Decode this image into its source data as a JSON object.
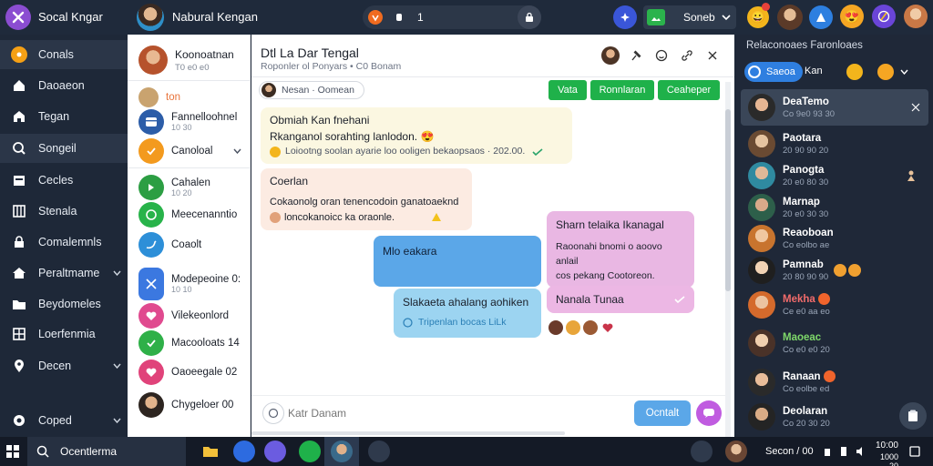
{
  "topbar": {
    "app_title": "Socal Kngar",
    "profile_name": "Nabural Kengan",
    "search_count": "1",
    "green_button": "Soneb"
  },
  "sidebar": {
    "items": [
      {
        "label": "Conals",
        "icon": "orange-circle-icon"
      },
      {
        "label": "Daoaeon",
        "icon": "home-icon"
      },
      {
        "label": "Tegan",
        "icon": "home-icon"
      },
      {
        "label": "Songeil",
        "icon": "chat-icon"
      },
      {
        "label": "Cecles",
        "icon": "calendar-icon"
      },
      {
        "label": "Stenala",
        "icon": "grid-icon"
      },
      {
        "label": "Comalemnls",
        "icon": "lock-icon"
      },
      {
        "label": "Peraltmame",
        "icon": "home-icon"
      },
      {
        "label": "Beydomeles",
        "icon": "folder-icon"
      },
      {
        "label": "Loerfenmia",
        "icon": "grid-icon"
      },
      {
        "label": "Decen",
        "icon": "location-icon"
      },
      {
        "label": "Coped",
        "icon": "settings-icon"
      }
    ]
  },
  "contacts": {
    "header_name": "Koonoatnan",
    "header_sub": "T0 e0 e0",
    "items": [
      {
        "label": "ton",
        "sub": "",
        "color": "#c9a36f"
      },
      {
        "label": "Fannelloohnel",
        "sub": "10 30",
        "color": "#2c5da8"
      },
      {
        "label": "Canoloal",
        "sub": "",
        "color": "#f39a1e"
      },
      {
        "label": "Cahalen",
        "sub": "10 20",
        "color": "#2c9e43"
      },
      {
        "label": "Meecenanntio",
        "sub": "",
        "color": "#28b34a"
      },
      {
        "label": "Coaolt",
        "sub": "",
        "color": "#2d8fd8"
      },
      {
        "label": "Modepeoine 0:",
        "sub": "10 10",
        "color": "#3b78e0"
      },
      {
        "label": "Vilekeonlord",
        "sub": "",
        "color": "#e04a8f"
      },
      {
        "label": "Macooloats 14",
        "sub": "",
        "color": "#2fb048"
      },
      {
        "label": "Oaoeegale 02",
        "sub": "",
        "color": "#e0437a"
      },
      {
        "label": "Chygeloer 00",
        "sub": "",
        "color": "#8a5a3a"
      }
    ]
  },
  "chat": {
    "title": "Dtl La Dar Tengal",
    "subtitle": "Roponler ol Ponyars • C0 Bonam",
    "search_placeholder": "Nesan · Oomean",
    "buttons": [
      "Vata",
      "Ronnlaran",
      "Ceaheper"
    ],
    "messages": [
      {
        "text1": "Obmiah Kan fnehani",
        "text2": "Rkanganol sorahting lanlodon. 😍",
        "text3": "Loiootng soolan ayarie loo ooligen bekaopsaos · 202.00."
      },
      {
        "title": "Coerlan",
        "text1": "Cokaonolg oran tenencodoin ganatoaeknd",
        "text2": "loncokanoicc ka oraonle."
      },
      {
        "title": "Sharn telaika Ikanagal",
        "text1": "Raoonahi bnomi o aoovo anlail",
        "text2": "cos pekang Cootoreon."
      },
      {
        "text1": "Mlo eakara"
      },
      {
        "title": "Slakaeta ahalang aohiken",
        "text1": "Tripenlan bocas LiLk"
      },
      {
        "text1": "Nanala Tunaa"
      }
    ],
    "input_placeholder": "Katr Danam",
    "send_button": "Ocntalt"
  },
  "right": {
    "header": "Relaconoaes Faronloaes",
    "filter": "Saeoa",
    "filter2": "Kan",
    "contacts": [
      {
        "name": "DeaTemo",
        "sub": "Co 9e0 93 30"
      },
      {
        "name": "Paotara",
        "sub": "20 90 90 20"
      },
      {
        "name": "Panogta",
        "sub": "20 e0 80 30"
      },
      {
        "name": "Marnap",
        "sub": "20 e0 30 30"
      },
      {
        "name": "Reaoboan",
        "sub": "Co eolbo ae"
      },
      {
        "name": "Pamnab",
        "sub": "20 80 90 90"
      },
      {
        "name": "Mekha",
        "sub": "Ce e0 aa eo"
      },
      {
        "name": "Maoeac",
        "sub": "Co e0 e0 20"
      },
      {
        "name": "Ranaan",
        "sub": "Co eolbe ed"
      },
      {
        "name": "Deolaran",
        "sub": "Co 20 30 20"
      }
    ]
  },
  "taskbar": {
    "search": "Ocentlerma",
    "status": "Secon / 00",
    "time": "10:00",
    "date": "1000 20"
  },
  "colors": {
    "accent_green": "#1fb14a",
    "accent_blue": "#2d8bd8",
    "dark_bg": "#1d2737"
  }
}
